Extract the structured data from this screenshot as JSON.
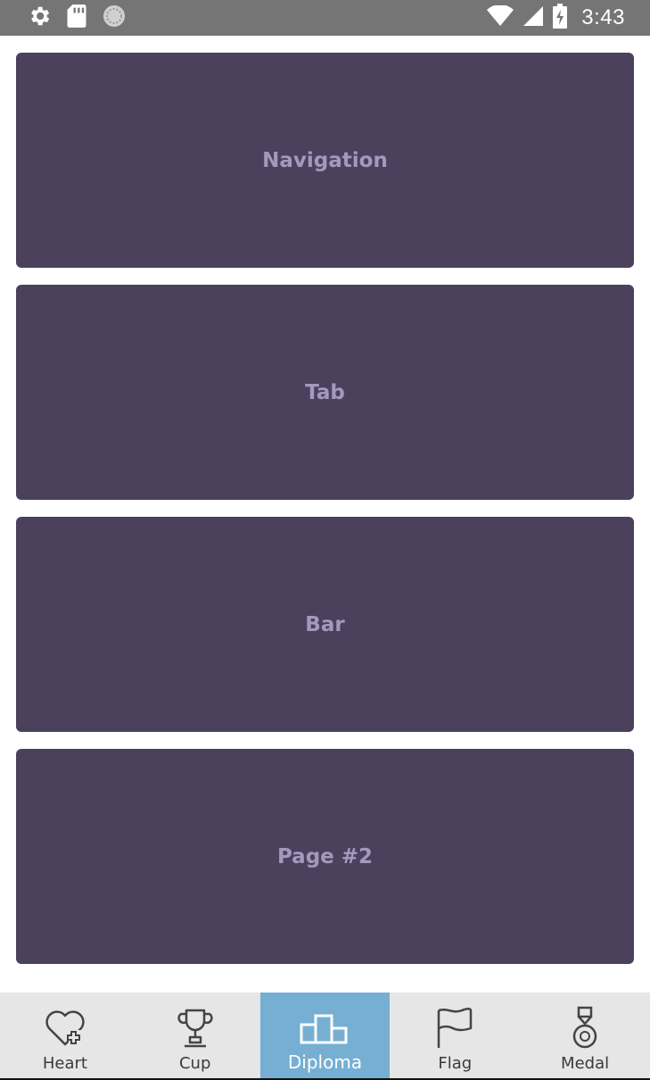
{
  "status_bar": {
    "time": "3:43",
    "icons": [
      "gear-icon",
      "sd-card-icon",
      "sync-icon",
      "wifi-icon",
      "cell-signal-icon",
      "battery-charging-icon"
    ]
  },
  "cards": [
    {
      "label": "Navigation"
    },
    {
      "label": "Tab"
    },
    {
      "label": "Bar"
    },
    {
      "label": "Page #2"
    }
  ],
  "colors": {
    "card_bg": "#4b415c",
    "card_text": "#a797be",
    "nav_bg": "#e6e6e6",
    "nav_active": "#76afd2",
    "status_bar": "#757575"
  },
  "bottom_nav": {
    "active_index": 2,
    "tabs": [
      {
        "label": "Heart",
        "icon": "heart-plus-icon"
      },
      {
        "label": "Cup",
        "icon": "trophy-icon"
      },
      {
        "label": "Diploma",
        "icon": "podium-icon"
      },
      {
        "label": "Flag",
        "icon": "flag-icon"
      },
      {
        "label": "Medal",
        "icon": "medal-icon"
      }
    ]
  }
}
